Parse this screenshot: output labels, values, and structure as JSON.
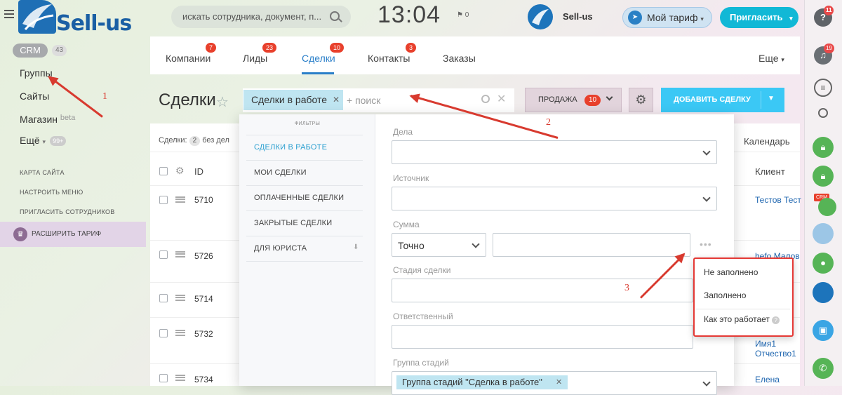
{
  "header": {
    "search_placeholder": "искать сотрудника, документ, п...",
    "time": "13:04",
    "flag_count": "0",
    "brand_name": "Sell-us",
    "tariff_button": "Мой тариф",
    "invite_button": "Пригласить"
  },
  "sidebar": {
    "logo_text": "Sell-us",
    "crm_label": "CRM",
    "crm_count": "43",
    "links": [
      "Группы",
      "Сайты",
      "Магазин",
      "Ещё"
    ],
    "shop_suffix": "beta",
    "more_badge": "99+",
    "small_links": [
      "КАРТА САЙТА",
      "НАСТРОИТЬ МЕНЮ",
      "ПРИГЛАСИТЬ СОТРУДНИКОВ"
    ],
    "expand_tariff": "РАСШИРИТЬ ТАРИФ"
  },
  "tabs": {
    "items": [
      {
        "label": "Компании",
        "badge": "7"
      },
      {
        "label": "Лиды",
        "badge": "23"
      },
      {
        "label": "Сделки",
        "badge": "10"
      },
      {
        "label": "Контакты",
        "badge": "3"
      },
      {
        "label": "Заказы",
        "badge": ""
      }
    ],
    "more": "Еще"
  },
  "toolbar": {
    "page_title": "Сделки",
    "filter_tag": "Сделки в работе",
    "filter_placeholder": "+ поиск",
    "sale_label": "ПРОДАЖА",
    "sale_count": "10",
    "add_deal": "ДОБАВИТЬ СДЕЛКУ"
  },
  "list": {
    "summary_label": "Сделки:",
    "summary_count": "2",
    "summary_suffix": "без дел",
    "calendar": "Календарь",
    "col_id": "ID",
    "col_client": "Клиент",
    "rows": [
      {
        "id": "5710",
        "client": "Тестов Тест"
      },
      {
        "id": "5726",
        "client": "hefo Малов\nв"
      },
      {
        "id": "5714",
        "client": ""
      },
      {
        "id": "5732",
        "client": "Имя1\nОтчество1"
      },
      {
        "id": "5734",
        "client": "Елена"
      }
    ]
  },
  "filter_popup": {
    "caption": "ФИЛЬТРЫ",
    "presets": [
      "СДЕЛКИ В РАБОТЕ",
      "МОИ СДЕЛКИ",
      "ОПЛАЧЕННЫЕ СДЕЛКИ",
      "ЗАКРЫТЫЕ СДЕЛКИ",
      "ДЛЯ ЮРИСТА"
    ],
    "fields": {
      "deals": "Дела",
      "source": "Источник",
      "amount": "Сумма",
      "amount_mode": "Точно",
      "stage": "Стадия сделки",
      "responsible": "Ответственный",
      "stage_group": "Группа стадий",
      "stage_group_value": "Группа стадий \"Сделка в работе\""
    }
  },
  "context_menu": {
    "items": [
      "Не заполнено",
      "Заполнено",
      "Как это работает"
    ]
  },
  "right_bar": {
    "help_badge": "11",
    "notify_badge": "19",
    "crm_label": "CRM"
  },
  "annotations": [
    "1",
    "2",
    "3"
  ],
  "colors": {
    "accent_blue": "#2a7fc9",
    "add_button": "#3bc8f5",
    "badge_red": "#e8402c",
    "annotation_red": "#d83a2f",
    "tag_blue": "#bfe5f1"
  }
}
